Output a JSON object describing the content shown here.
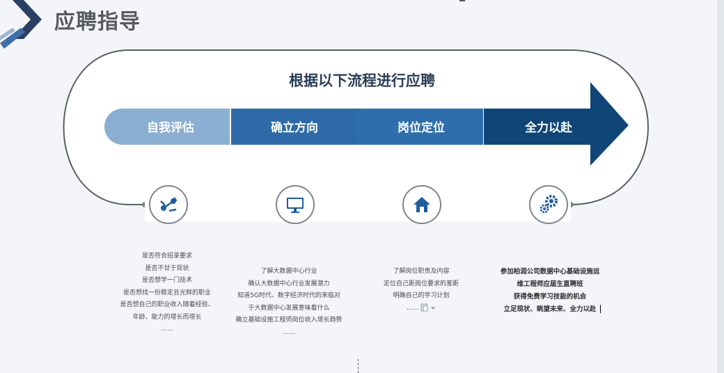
{
  "page": {
    "title": "应聘指导"
  },
  "flow": {
    "heading": "根据以下流程进行应聘",
    "steps": [
      {
        "label": "自我评估",
        "color": "#8aafd3"
      },
      {
        "label": "确立方向",
        "color": "#2e6aa8"
      },
      {
        "label": "岗位定位",
        "color": "#2f6eac"
      },
      {
        "label": "全力以赴",
        "color": "#0f4677"
      }
    ],
    "icons": [
      "share-arrows-icon",
      "monitor-icon",
      "home-icon",
      "gears-icon"
    ]
  },
  "descriptions": [
    {
      "lines": [
        "是否符合招录要求",
        "是否不甘于现状",
        "是否想学一门技术",
        "是否想找一份稳定且光鲜的职业",
        "是否想自己的职业收入随着经验、",
        "年龄、能力的增长而增长",
        "……"
      ]
    },
    {
      "lines": [
        "了解大数据中心行业",
        "确认大数据中心行业发展潜力",
        "知道5G时代、数字经济时代的来临对",
        "于大数据中心发展意味着什么",
        "确立基础设施工程师岗位收入增长趋势",
        "……"
      ]
    },
    {
      "lines": [
        "了解岗位职责及内容",
        "定位自己距岗位要求的差距",
        "明确自己的学习计划",
        "……"
      ]
    },
    {
      "lines": [
        "参加柏润公司数据中心基础设施运",
        "维工程师应届生直聘班",
        "获得免费学习技能的机会",
        "立足现状、眺望未来、全力以赴"
      ]
    }
  ],
  "colors": {
    "title_text": "#555a60",
    "heading_text": "#2a3c57",
    "frame_line": "#595f66"
  }
}
